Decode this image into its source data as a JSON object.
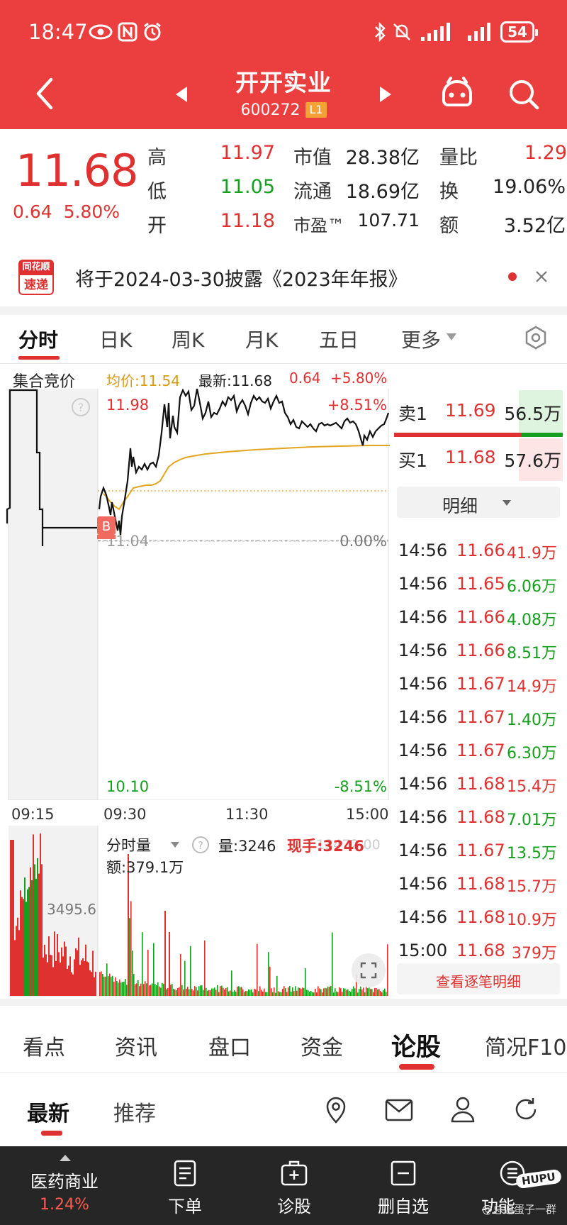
{
  "status": {
    "time": "18:47",
    "battery": "54"
  },
  "header": {
    "name": "开开实业",
    "code": "600272",
    "level": "L1"
  },
  "quote": {
    "last": "11.68",
    "change": "0.64",
    "pct": "5.80%",
    "rows": [
      [
        {
          "label": "高",
          "value": "11.97"
        },
        {
          "label": "市值",
          "value": "28.38亿"
        },
        {
          "label": "量比",
          "value": "1.29"
        }
      ],
      [
        {
          "label": "低",
          "value": "11.05"
        },
        {
          "label": "流通",
          "value": "18.69亿"
        },
        {
          "label": "换",
          "value": "19.06%"
        }
      ],
      [
        {
          "label": "开",
          "value": "11.18"
        },
        {
          "label": "市盈™",
          "value": "107.71"
        },
        {
          "label": "额",
          "value": "3.52亿"
        }
      ]
    ]
  },
  "news": {
    "logo_top": "同花顺",
    "logo_bottom": "速递",
    "text": "将于2024-03-30披露《2023年年报》"
  },
  "chart_tabs": [
    "分时",
    "日K",
    "周K",
    "月K",
    "五日",
    "更多"
  ],
  "chart_info": {
    "auction": "集合竞价",
    "avg": "均价:11.54",
    "latest": "最新:11.68",
    "chg": "0.64",
    "pct": "+5.80%",
    "high_price": "11.98",
    "high_pct": "+8.51%",
    "prev_close": "11.04",
    "zero_pct": "0.00%",
    "low_price": "10.10",
    "low_pct": "-8.51%",
    "marker": "B",
    "times": [
      "09:15",
      "09:30",
      "11:30",
      "15:00"
    ],
    "vol_label": "分时量",
    "vol": "量:3246",
    "hand": "现手:3246",
    "hand_overlay": "13472.00",
    "amount": "额:379.1万",
    "vol_axis": "3495.6"
  },
  "order_book": {
    "ask_label": "卖1",
    "ask_price": "11.69",
    "ask_vol": "56.5万",
    "bid_label": "买1",
    "bid_price": "11.68",
    "bid_vol": "57.6万",
    "detail": "明细",
    "more": "查看逐笔明细",
    "ticks": [
      {
        "time": "14:56",
        "price": "11.66",
        "vol": "41.9万",
        "price_color": "#e03131",
        "vol_color": "#e03131"
      },
      {
        "time": "14:56",
        "price": "11.65",
        "vol": "6.06万",
        "price_color": "#e03131",
        "vol_color": "#14a01e"
      },
      {
        "time": "14:56",
        "price": "11.66",
        "vol": "4.08万",
        "price_color": "#e03131",
        "vol_color": "#14a01e"
      },
      {
        "time": "14:56",
        "price": "11.66",
        "vol": "8.51万",
        "price_color": "#e03131",
        "vol_color": "#14a01e"
      },
      {
        "time": "14:56",
        "price": "11.67",
        "vol": "14.9万",
        "price_color": "#e03131",
        "vol_color": "#e03131"
      },
      {
        "time": "14:56",
        "price": "11.67",
        "vol": "1.40万",
        "price_color": "#e03131",
        "vol_color": "#14a01e"
      },
      {
        "time": "14:56",
        "price": "11.67",
        "vol": "6.30万",
        "price_color": "#e03131",
        "vol_color": "#14a01e"
      },
      {
        "time": "14:56",
        "price": "11.68",
        "vol": "15.4万",
        "price_color": "#e03131",
        "vol_color": "#e03131"
      },
      {
        "time": "14:56",
        "price": "11.68",
        "vol": "7.01万",
        "price_color": "#e03131",
        "vol_color": "#14a01e"
      },
      {
        "time": "14:56",
        "price": "11.67",
        "vol": "13.5万",
        "price_color": "#e03131",
        "vol_color": "#14a01e"
      },
      {
        "time": "14:56",
        "price": "11.68",
        "vol": "15.7万",
        "price_color": "#e03131",
        "vol_color": "#e03131"
      },
      {
        "time": "14:56",
        "price": "11.68",
        "vol": "10.9万",
        "price_color": "#e03131",
        "vol_color": "#e03131"
      },
      {
        "time": "15:00",
        "price": "11.68",
        "vol": "379万",
        "price_color": "#e03131",
        "vol_color": "#e03131"
      }
    ]
  },
  "info_tabs": [
    "看点",
    "资讯",
    "盘口",
    "资金",
    "论股",
    "简况F10"
  ],
  "sub_tabs": [
    "最新",
    "推荐"
  ],
  "bottom_bar": {
    "sector": "医药商业",
    "sector_pct": "1.24%",
    "items": [
      "下单",
      "诊股",
      "删自选",
      "功能"
    ]
  },
  "watermark": "@总遍蛋子一群",
  "hupu": "HUPU",
  "colors": {
    "header": "#ea3f3e",
    "up": "#e03131",
    "down": "#14a01e",
    "avg_line": "#e3a520"
  }
}
